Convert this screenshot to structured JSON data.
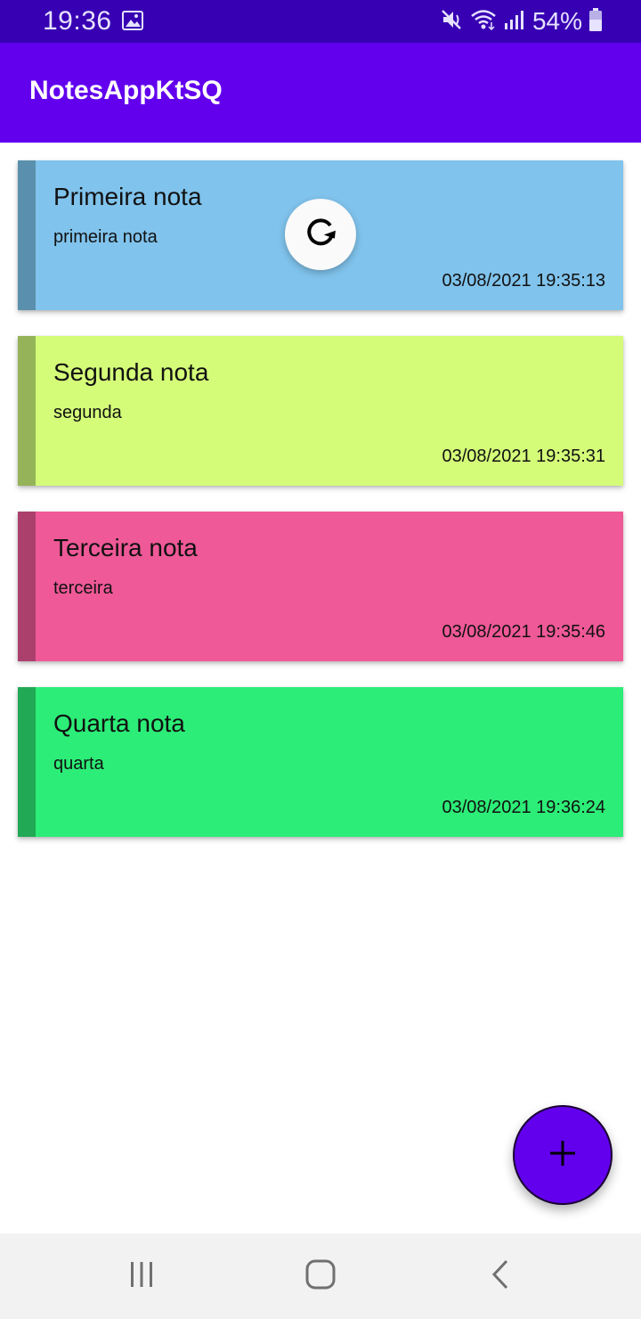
{
  "status_bar": {
    "time": "19:36",
    "battery": "54%",
    "icons": [
      "image-icon",
      "mute-icon",
      "wifi-icon",
      "signal-icon",
      "battery-icon"
    ]
  },
  "app_bar": {
    "title": "NotesAppKtSQ"
  },
  "notes": [
    {
      "title": "Primeira nota",
      "body": "primeira nota",
      "date": "03/08/2021 19:35:13",
      "color": "#80c3ec",
      "stripe": "#5a90ad"
    },
    {
      "title": "Segunda nota",
      "body": "segunda",
      "date": "03/08/2021 19:35:31",
      "color": "#d4fc79",
      "stripe": "#95b459"
    },
    {
      "title": "Terceira nota",
      "body": "terceira",
      "date": "03/08/2021 19:35:46",
      "color": "#ef5997",
      "stripe": "#ab406d"
    },
    {
      "title": "Quarta nota",
      "body": "quarta",
      "date": "03/08/2021 19:36:24",
      "color": "#2ced77",
      "stripe": "#21a955"
    }
  ],
  "refresh_indicator": {
    "icon": "refresh-icon"
  },
  "fab": {
    "icon": "plus-icon",
    "color": "#6200ee"
  },
  "nav_bar": {
    "icons": [
      "recents-icon",
      "home-icon",
      "back-icon"
    ]
  },
  "colors": {
    "status_bar": "#3700b3",
    "app_bar": "#6200ee"
  }
}
